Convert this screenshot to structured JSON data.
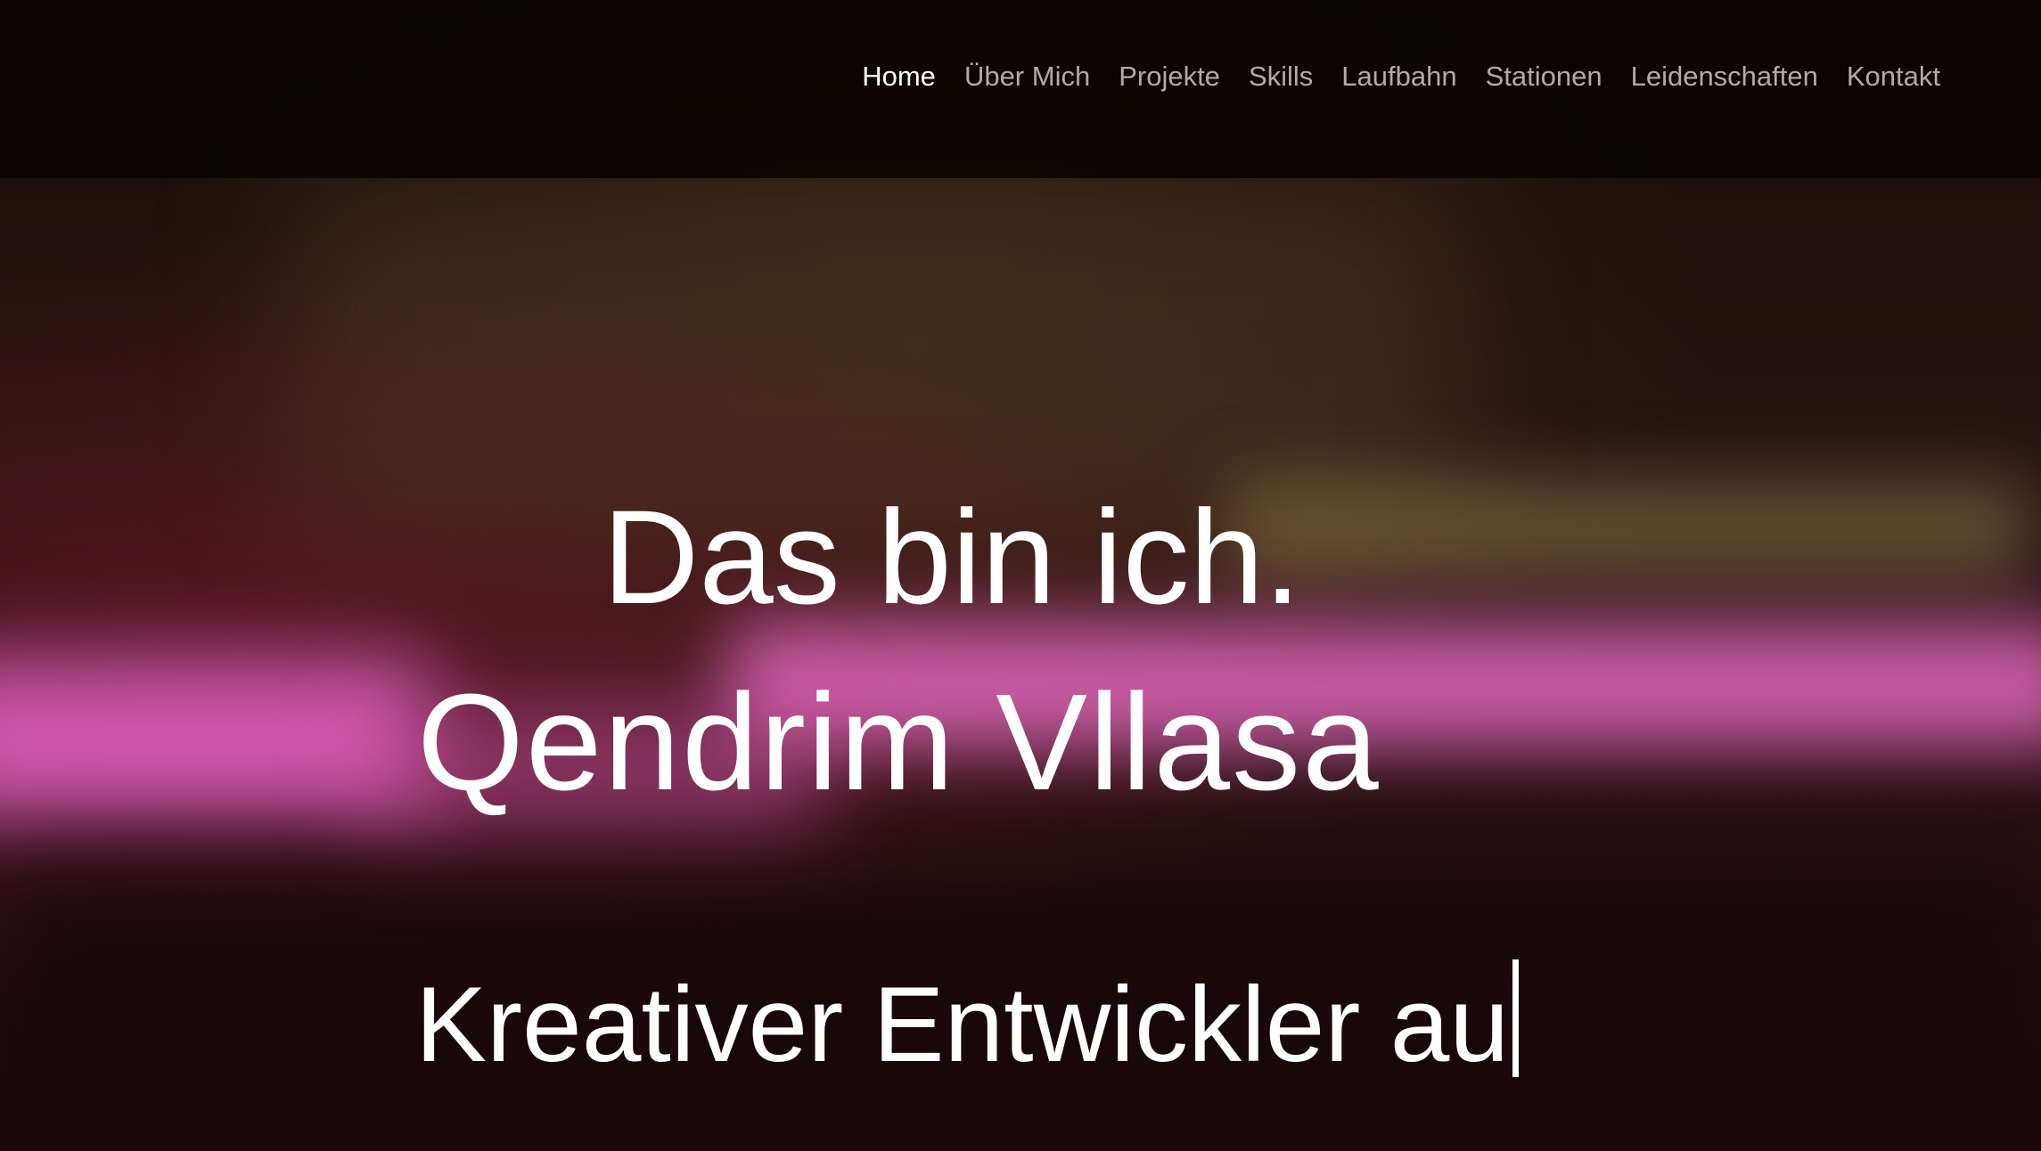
{
  "nav": {
    "items": [
      {
        "label": "Home",
        "active": true
      },
      {
        "label": "Über Mich",
        "active": false
      },
      {
        "label": "Projekte",
        "active": false
      },
      {
        "label": "Skills",
        "active": false
      },
      {
        "label": "Laufbahn",
        "active": false
      },
      {
        "label": "Stationen",
        "active": false
      },
      {
        "label": "Leidenschaften",
        "active": false
      },
      {
        "label": "Kontakt",
        "active": false
      }
    ]
  },
  "hero": {
    "greeting": "Das bin ich.",
    "name": "Qendrim Vllasa",
    "typed_text": "Kreativer Entwickler au"
  },
  "colors": {
    "accent_glow": "#e468c0",
    "nav_text": "#b3aaa6",
    "nav_active": "#ffffff"
  }
}
